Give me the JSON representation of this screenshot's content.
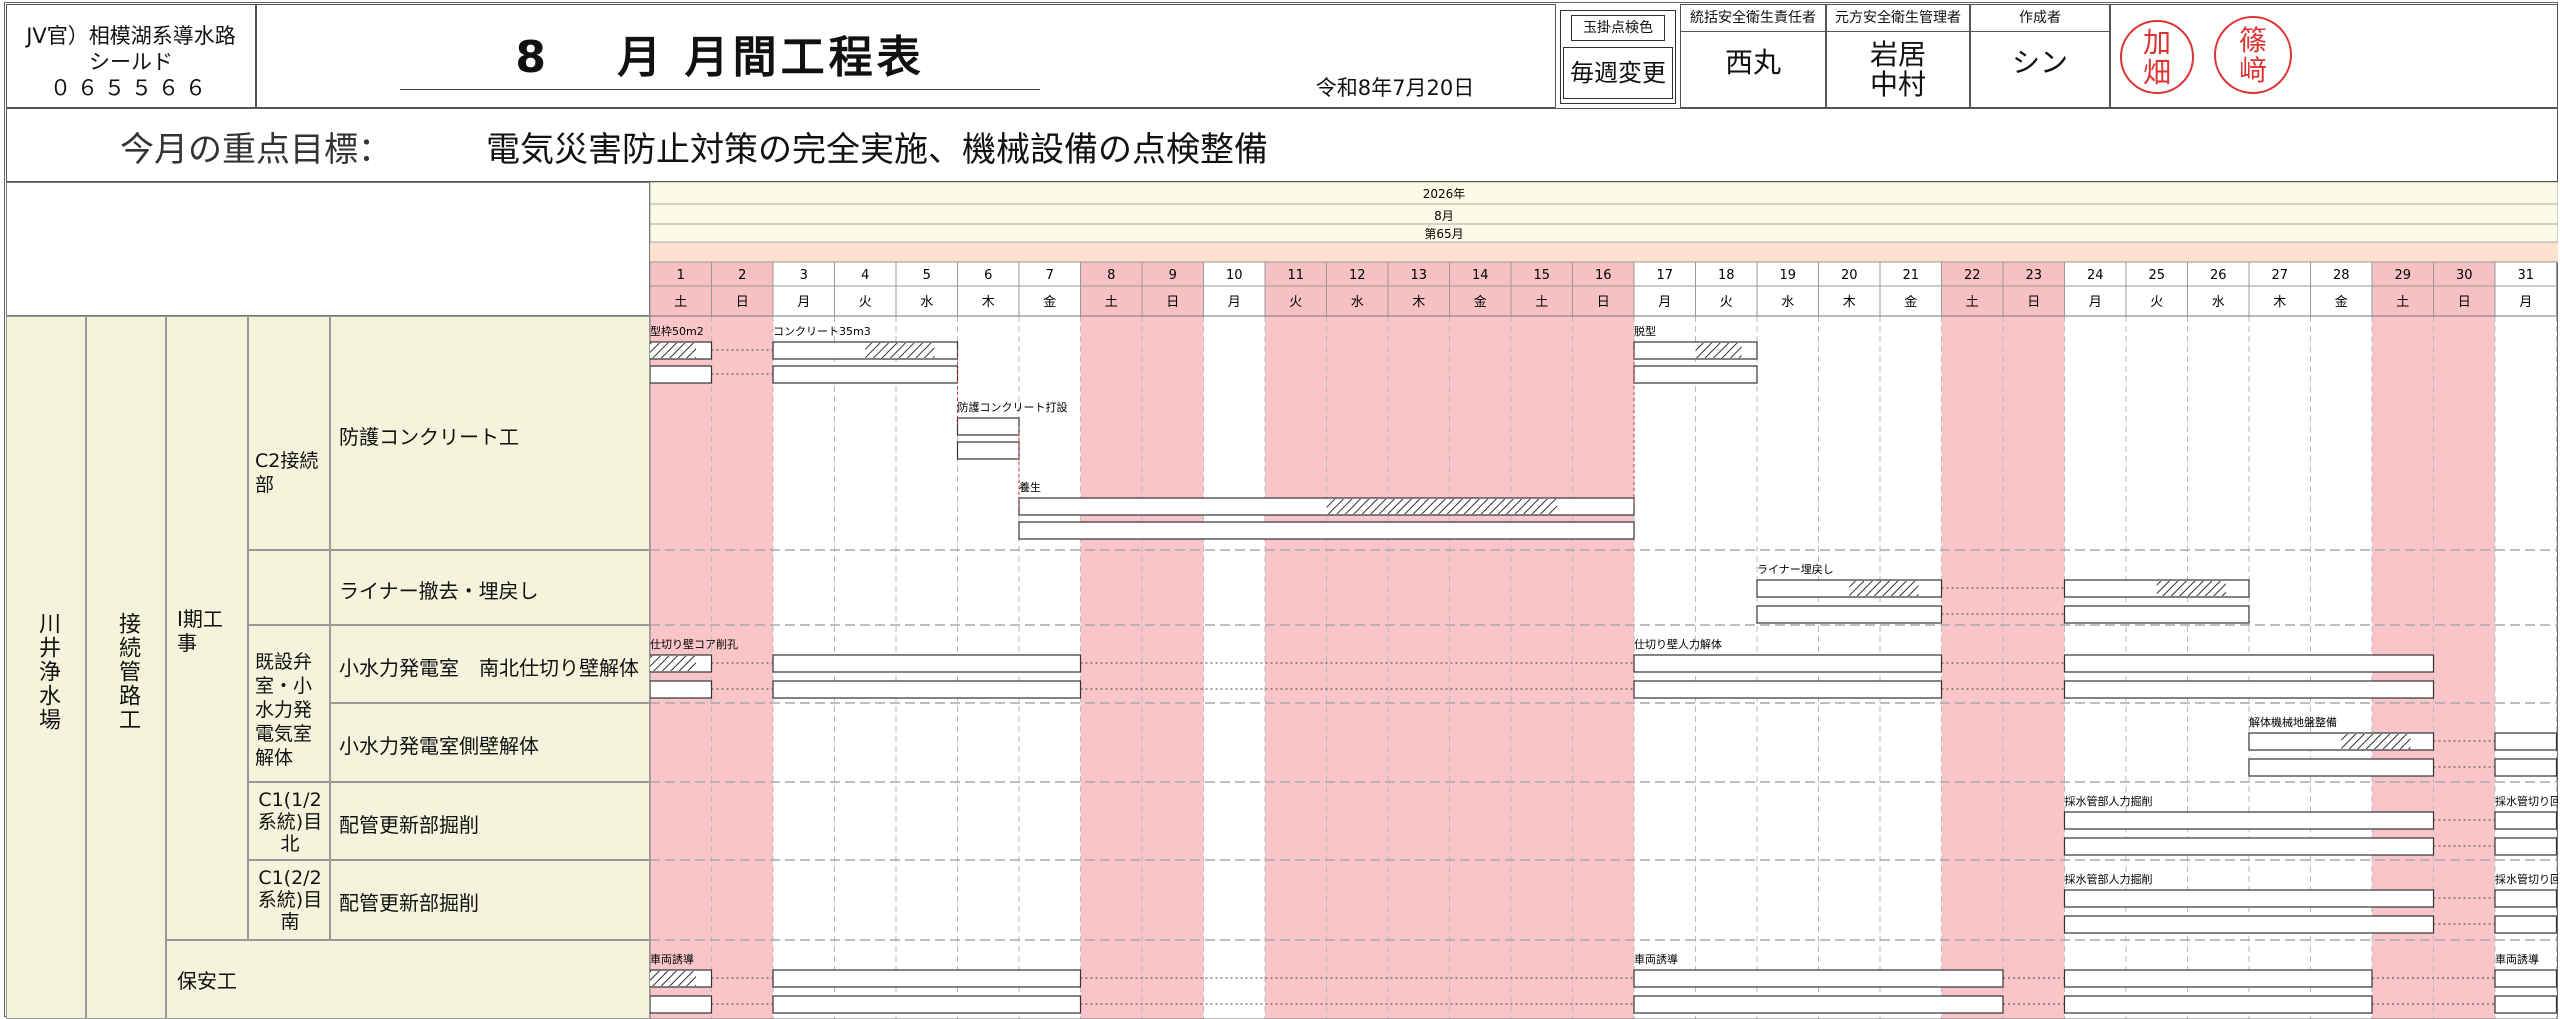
{
  "header": {
    "project_lines": [
      "JV官）相模湖系導水路",
      "シールド",
      "０６５５６６"
    ],
    "title": "8　 月 月間工程表",
    "date": "令和8年7月20日",
    "roles": [
      {
        "header": "玉掛点検色",
        "value": "毎週変更"
      },
      {
        "header": "統括安全衛生責任者",
        "value": "西丸"
      },
      {
        "header": "元方安全衛生管理者",
        "value": "岩居\n中村"
      },
      {
        "header": "作成者",
        "value": "シン"
      }
    ],
    "stamps": [
      "加畑",
      "篠﨑"
    ]
  },
  "goal": {
    "label": "今月の重点目標：",
    "text": "電気災害防止対策の完全実施、機械設備の点検整備"
  },
  "calendar": {
    "year": "2026年",
    "month": "8月",
    "week": "第65月",
    "days": [
      1,
      2,
      3,
      4,
      5,
      6,
      7,
      8,
      9,
      10,
      11,
      12,
      13,
      14,
      15,
      16,
      17,
      18,
      19,
      20,
      21,
      22,
      23,
      24,
      25,
      26,
      27,
      28,
      29,
      30,
      31
    ],
    "weekdays": [
      "土",
      "日",
      "月",
      "火",
      "水",
      "木",
      "金",
      "土",
      "日",
      "月",
      "火",
      "水",
      "木",
      "金",
      "土",
      "日",
      "月",
      "火",
      "水",
      "木",
      "金",
      "土",
      "日",
      "月",
      "火",
      "水",
      "木",
      "金",
      "土",
      "日",
      "月"
    ],
    "holidays": [
      1,
      2,
      8,
      9,
      11,
      12,
      13,
      14,
      15,
      16,
      22,
      23,
      29,
      30
    ]
  },
  "hierarchy": {
    "site": "川井浄水場",
    "work": "接続管路工",
    "phase": "Ⅰ期工事",
    "guard": "保安工"
  },
  "groups": [
    {
      "name": "C2接続部"
    },
    {
      "name": "既設弁室・小水力発電気室解体"
    },
    {
      "name": "C1(1/2系統)目北"
    },
    {
      "name": "C1(2/2系統)目南"
    }
  ],
  "rows": [
    {
      "label": "防護コンクリート工",
      "tasks": [
        {
          "label": "型枠50m2",
          "start": 1,
          "end": 1,
          "hatch_start": 1,
          "hatch_end": 1
        },
        {
          "label": "コンクリート35m3",
          "start": 3,
          "end": 5,
          "hatch_start": 4.5,
          "hatch_end": 5
        },
        {
          "label": "防護コンクリート打設",
          "start": 6,
          "end": 6,
          "hatch_start": null,
          "hatch_end": null
        },
        {
          "label": "養生",
          "start": 7,
          "end": 16,
          "hatch_start": 12,
          "hatch_end": 16
        },
        {
          "label": "脱型",
          "start": 17,
          "end": 18,
          "hatch_start": 18,
          "hatch_end": 18
        }
      ]
    },
    {
      "label": "ライナー撤去・埋戻し",
      "tasks": [
        {
          "label": "ライナー埋戻し",
          "start": 19,
          "end": 21,
          "hatch_start": 20.5,
          "hatch_end": 21
        },
        {
          "label": "",
          "start": 24,
          "end": 26,
          "hatch_start": 25.5,
          "hatch_end": 26
        }
      ]
    },
    {
      "label": "小水力発電室　南北仕切り壁解体",
      "tasks": [
        {
          "label": "仕切り壁コア削孔",
          "start": 1,
          "end": 1,
          "hatch_start": 1.3,
          "hatch_end": 1
        },
        {
          "label": "",
          "start": 3,
          "end": 7,
          "hatch_start": null,
          "hatch_end": null
        },
        {
          "label": "仕切り壁人力解体",
          "start": 17,
          "end": 21,
          "hatch_start": null,
          "hatch_end": null
        },
        {
          "label": "",
          "start": 24,
          "end": 29,
          "hatch_start": null,
          "hatch_end": null
        }
      ]
    },
    {
      "label": "小水力発電室側壁解体",
      "tasks": [
        {
          "label": "解体機械地盤整備",
          "start": 27,
          "end": 29,
          "hatch_start": 28.5,
          "hatch_end": 29
        },
        {
          "label": "",
          "start": 31,
          "end": 31,
          "hatch_start": null,
          "hatch_end": null
        }
      ]
    },
    {
      "label": "配管更新部掘削",
      "tasks": [
        {
          "label": "採水管部人力掘削",
          "start": 24,
          "end": 29,
          "hatch_start": null,
          "hatch_end": null
        },
        {
          "label": "採水管切り回し",
          "start": 31,
          "end": 31,
          "hatch_start": null,
          "hatch_end": null
        }
      ]
    },
    {
      "label": "配管更新部掘削",
      "tasks": [
        {
          "label": "採水管部人力掘削",
          "start": 24,
          "end": 29,
          "hatch_start": null,
          "hatch_end": null
        },
        {
          "label": "採水管切り回し",
          "start": 31,
          "end": 31,
          "hatch_start": null,
          "hatch_end": null
        }
      ]
    },
    {
      "label": "",
      "tasks": [
        {
          "label": "車両誘導",
          "start": 1,
          "end": 1,
          "hatch_start": 1,
          "hatch_end": 1
        },
        {
          "label": "",
          "start": 3,
          "end": 7,
          "hatch_start": null,
          "hatch_end": null
        },
        {
          "label": "車両誘導",
          "start": 17,
          "end": 22,
          "hatch_start": null,
          "hatch_end": null
        },
        {
          "label": "",
          "start": 24,
          "end": 28,
          "hatch_start": null,
          "hatch_end": null
        },
        {
          "label": "車両誘導",
          "start": 31,
          "end": 31,
          "hatch_start": null,
          "hatch_end": null
        }
      ]
    }
  ]
}
